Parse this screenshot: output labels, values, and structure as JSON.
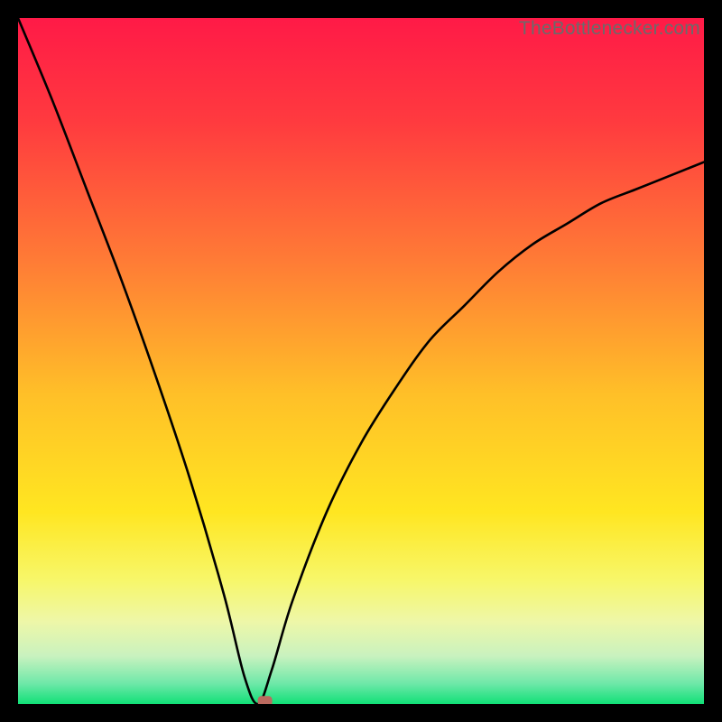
{
  "watermark": "TheBottlenecker.com",
  "chart_data": {
    "type": "line",
    "title": "",
    "xlabel": "",
    "ylabel": "",
    "xlim": [
      0,
      100
    ],
    "ylim": [
      0,
      100
    ],
    "min_x": 35,
    "series": [
      {
        "name": "bottleneck-curve",
        "x": [
          0,
          5,
          10,
          15,
          20,
          25,
          30,
          33,
          35,
          37,
          40,
          45,
          50,
          55,
          60,
          65,
          70,
          75,
          80,
          85,
          90,
          95,
          100
        ],
        "values": [
          100,
          88,
          75,
          62,
          48,
          33,
          16,
          4,
          0,
          5,
          15,
          28,
          38,
          46,
          53,
          58,
          63,
          67,
          70,
          73,
          75,
          77,
          79
        ]
      }
    ],
    "marker": {
      "x": 36,
      "y": 0.5,
      "color": "#bb6a5f"
    },
    "gradient_stops": [
      {
        "offset": 0.0,
        "color": "#ff1a47"
      },
      {
        "offset": 0.15,
        "color": "#ff3a3f"
      },
      {
        "offset": 0.35,
        "color": "#ff7a36"
      },
      {
        "offset": 0.55,
        "color": "#ffc028"
      },
      {
        "offset": 0.72,
        "color": "#ffe621"
      },
      {
        "offset": 0.82,
        "color": "#f7f76a"
      },
      {
        "offset": 0.88,
        "color": "#eef7a8"
      },
      {
        "offset": 0.93,
        "color": "#c9f2bf"
      },
      {
        "offset": 0.97,
        "color": "#6fe8a9"
      },
      {
        "offset": 1.0,
        "color": "#11e077"
      }
    ]
  }
}
